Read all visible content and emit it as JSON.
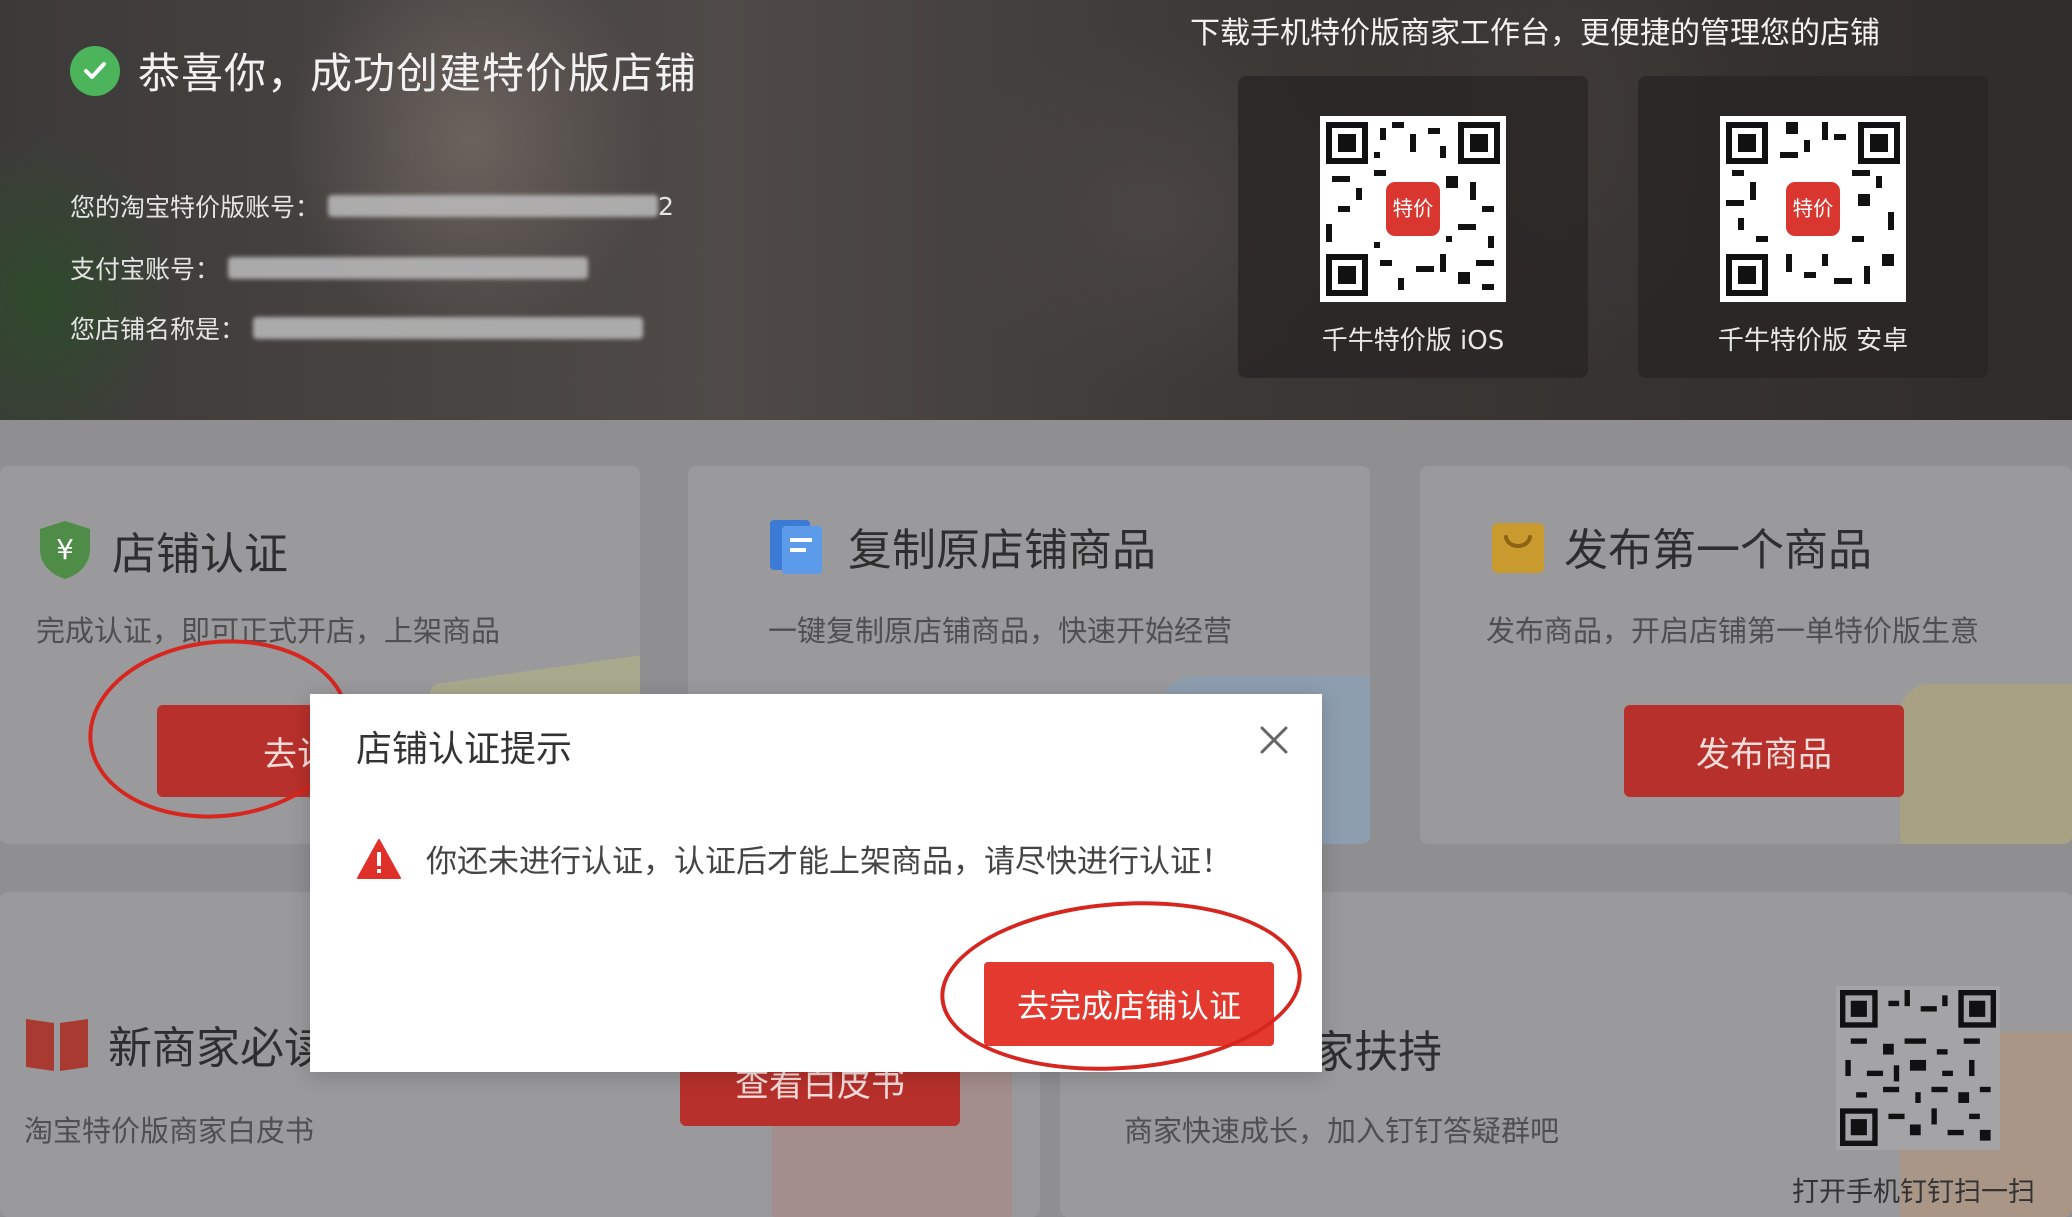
{
  "hero": {
    "title": "恭喜你，成功创建特价版店铺",
    "account_label": "您的淘宝特价版账号：",
    "account_visible_tail": "2",
    "alipay_label": "支付宝账号：",
    "shop_name_label": "您店铺名称是：",
    "download_tip": "下载手机特价版商家工作台，更便捷的管理您的店铺",
    "qr_ios_label": "千牛特价版 iOS",
    "qr_android_label": "千牛特价版 安卓",
    "qr_badge": "特价"
  },
  "cards": {
    "certify": {
      "title": "店铺认证",
      "desc": "完成认证，即可正式开店，上架商品",
      "button": "去认"
    },
    "copy": {
      "title": "复制原店铺商品",
      "desc": "一键复制原店铺商品，快速开始经营"
    },
    "publish": {
      "title": "发布第一个商品",
      "desc": "发布商品，开启店铺第一单特价版生意",
      "button": "发布商品"
    },
    "newbie": {
      "title": "新商家必读",
      "desc": "淘宝特价版商家白皮书",
      "button": "查看白皮书"
    },
    "support": {
      "title": "家扶持",
      "desc": "商家快速成长，加入钉钉答疑群吧",
      "qr_label": "打开手机钉钉扫一扫"
    }
  },
  "modal": {
    "title": "店铺认证提示",
    "message": "你还未进行认证，认证后才能上架商品，请尽快进行认证！",
    "primary_button": "去完成店铺认证"
  },
  "colors": {
    "primary_red": "#e3392f",
    "dim_red": "#b8302b",
    "success_green": "#4cb45a",
    "warning_red": "#e0302a"
  }
}
